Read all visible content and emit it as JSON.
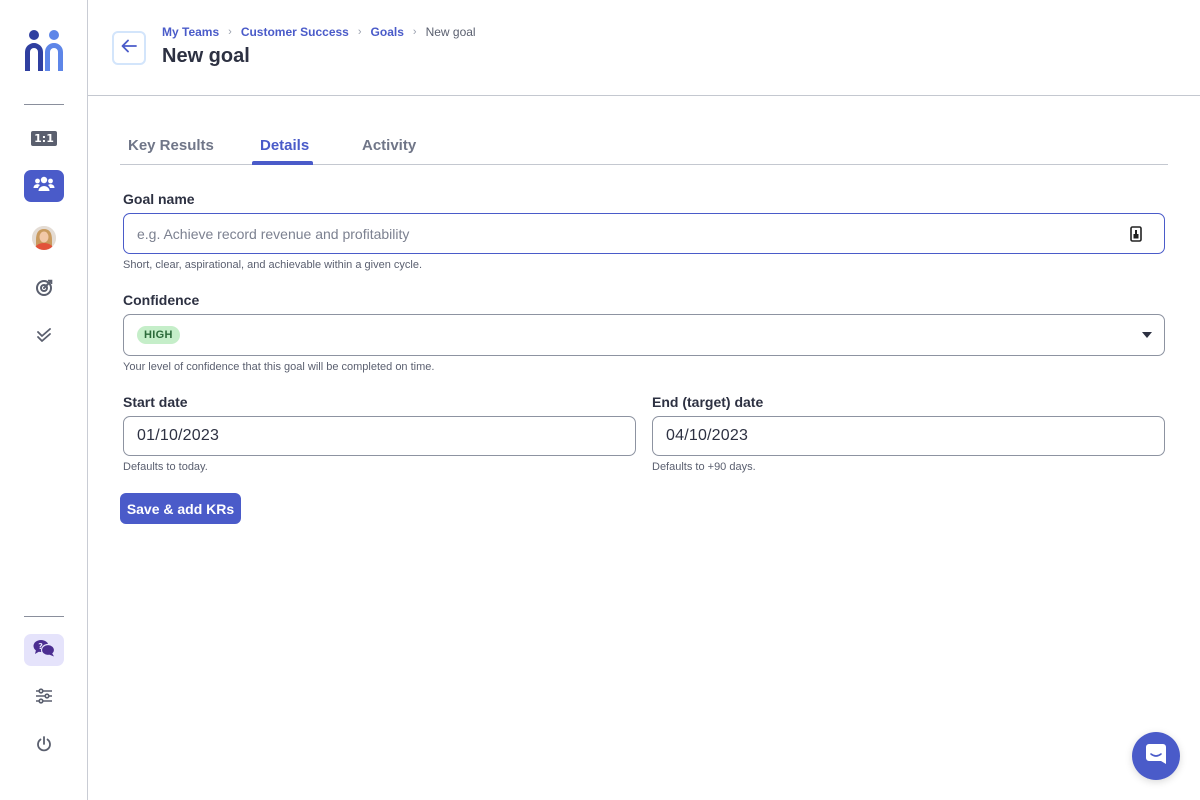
{
  "sidebar": {
    "logo": "mentor-logo",
    "items": [
      {
        "name": "one-on-one",
        "label": "1:1",
        "icon": "one-on-one-icon",
        "active": false
      },
      {
        "name": "teams",
        "icon": "team-icon",
        "active": true
      },
      {
        "name": "profile",
        "icon": "avatar",
        "active": false
      },
      {
        "name": "goals",
        "icon": "target-icon",
        "active": false
      },
      {
        "name": "tasks",
        "icon": "double-check-icon",
        "active": false
      }
    ],
    "bottom_items": [
      {
        "name": "help",
        "icon": "help-chat-icon",
        "active": true
      },
      {
        "name": "settings",
        "icon": "sliders-icon"
      },
      {
        "name": "logout",
        "icon": "power-icon"
      }
    ]
  },
  "header": {
    "breadcrumb": [
      "My Teams",
      "Customer Success",
      "Goals",
      "New goal"
    ],
    "title": "New goal"
  },
  "tabs": [
    {
      "label": "Key Results",
      "active": false
    },
    {
      "label": "Details",
      "active": true
    },
    {
      "label": "Activity",
      "active": false
    }
  ],
  "form": {
    "goal_name": {
      "label": "Goal name",
      "value": "",
      "placeholder": "e.g. Achieve record revenue and profitability",
      "hint": "Short, clear, aspirational, and achievable within a given cycle."
    },
    "confidence": {
      "label": "Confidence",
      "selected": "HIGH",
      "selected_color": "#c5eec9",
      "hint": "Your level of confidence that this goal will be completed on time."
    },
    "start_date": {
      "label": "Start date",
      "value": "01/10/2023",
      "hint": "Defaults to today."
    },
    "end_date": {
      "label": "End (target) date",
      "value": "04/10/2023",
      "hint": "Defaults to +90 days."
    },
    "submit_label": "Save & add KRs"
  },
  "colors": {
    "accent": "#4a5bc9",
    "soft_accent": "#e5e3fb"
  }
}
